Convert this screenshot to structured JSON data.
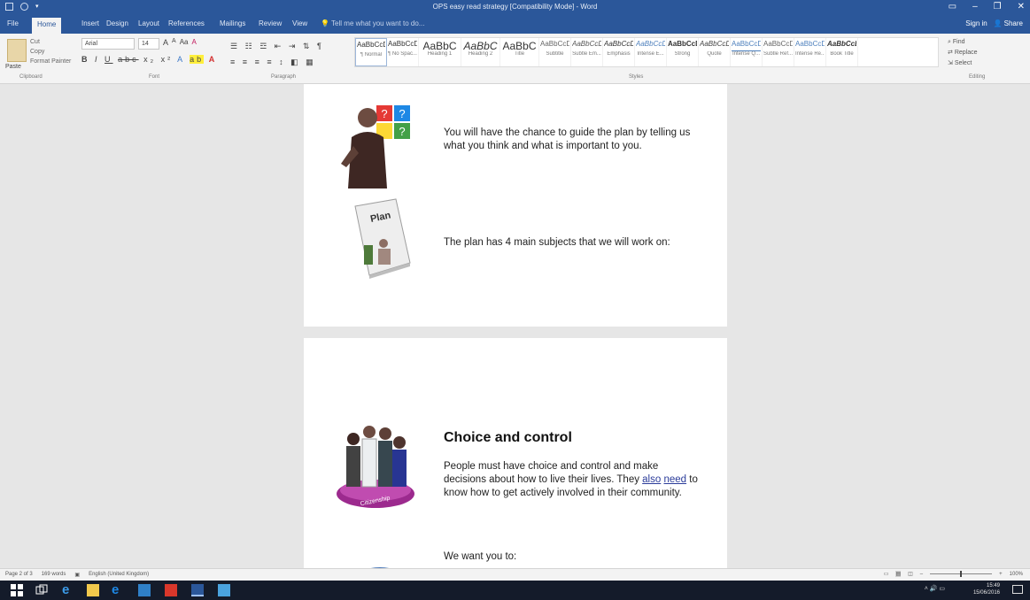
{
  "window": {
    "title": "OPS easy read strategy [Compatibility Mode] - Word",
    "controls": [
      "▭",
      "–",
      "❐",
      "✕"
    ]
  },
  "tabs": [
    {
      "label": "File"
    },
    {
      "label": "Home"
    },
    {
      "label": "Insert"
    },
    {
      "label": "Design"
    },
    {
      "label": "Layout"
    },
    {
      "label": "References"
    },
    {
      "label": "Mailings"
    },
    {
      "label": "Review"
    },
    {
      "label": "View"
    },
    {
      "label": "Tell me what you want to do..."
    }
  ],
  "account": {
    "signin": "Sign in",
    "share": "Share"
  },
  "ribbon": {
    "clipboard": {
      "paste": "Paste",
      "cut": "Cut",
      "copy": "Copy",
      "format_painter": "Format Painter"
    },
    "font": {
      "name": "Arial",
      "size": "14"
    },
    "styles": [
      {
        "sample": "AaBbCcDc",
        "name": "¶ Normal"
      },
      {
        "sample": "AaBbCcDc",
        "name": "¶ No Spac..."
      },
      {
        "sample": "AaBbC",
        "name": "Heading 1"
      },
      {
        "sample": "AaBbC",
        "name": "Heading 2"
      },
      {
        "sample": "AaBbC",
        "name": "Title"
      },
      {
        "sample": "AaBbCcD",
        "name": "Subtitle"
      },
      {
        "sample": "AaBbCcDa",
        "name": "Subtle Em..."
      },
      {
        "sample": "AaBbCcDa",
        "name": "Emphasis"
      },
      {
        "sample": "AaBbCcDa",
        "name": "Intense E..."
      },
      {
        "sample": "AaBbCcDa",
        "name": "Strong"
      },
      {
        "sample": "AaBbCcDa",
        "name": "Quote"
      },
      {
        "sample": "AaBbCcDa",
        "name": "Intense Q..."
      },
      {
        "sample": "AaBbCcDa",
        "name": "Subtle Ref..."
      },
      {
        "sample": "AaBbCcDa",
        "name": "Intense Re..."
      },
      {
        "sample": "AaBbCcDa",
        "name": "Book Title"
      }
    ],
    "editing": {
      "find": "Find",
      "replace": "Replace",
      "select": "Select"
    },
    "groups": {
      "clipboard": "Clipboard",
      "font": "Font",
      "paragraph": "Paragraph",
      "styles": "Styles",
      "editing": "Editing"
    }
  },
  "document": {
    "page1": {
      "para1": "You will have the chance to guide the plan by telling us what you think and what is important to you.",
      "plan_image_text": "Plan",
      "para2": "The plan has 4 main subjects that we will work on:"
    },
    "page2": {
      "heading": "Choice and control",
      "para_before_link": "People must have choice and control and make decisions about how to live their lives.  They ",
      "link1": "also",
      "link2": "need",
      "para_after_link": " to know how to get actively involved in their community.",
      "citizenship_label": "Citizenship",
      "para3": "We want you to:"
    }
  },
  "statusbar": {
    "page": "Page 2 of 3",
    "words": "169 words",
    "language": "English (United Kingdom)",
    "zoom": "100%"
  },
  "taskbar": {
    "time": "15:49",
    "date": "15/06/2016"
  }
}
